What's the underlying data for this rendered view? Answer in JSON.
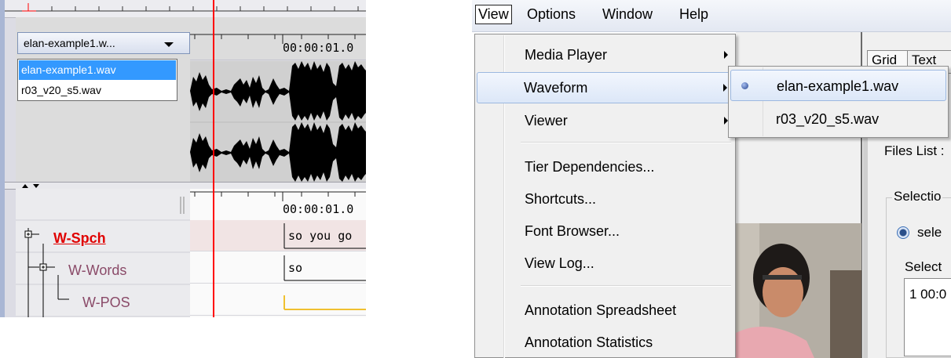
{
  "left_panel": {
    "media_combo": {
      "selected": "elan-example1.w...",
      "options": [
        "elan-example1.wav",
        "r03_v20_s5.wav"
      ]
    },
    "timecode_waveform": "00:00:01.0",
    "timecode_tiers": "00:00:01.0",
    "tiers": [
      {
        "name": "W-Spch",
        "annotation": "so you go"
      },
      {
        "name": "W-Words",
        "annotation": "so"
      },
      {
        "name": "W-POS",
        "annotation": ""
      }
    ],
    "colors": {
      "active_tier": "#e00000",
      "tier": "#8a4a68",
      "crosshair": "#ff0000",
      "pos_annotation": "#f0c030"
    }
  },
  "right_panel": {
    "menubar": {
      "view": "View",
      "options": "Options",
      "window": "Window",
      "help": "Help"
    },
    "view_menu": {
      "items": [
        {
          "label": "Media Player",
          "submenu": true
        },
        {
          "label": "Waveform",
          "submenu": true,
          "highlighted": true
        },
        {
          "label": "Viewer",
          "submenu": true
        },
        {
          "label": "Tier Dependencies..."
        },
        {
          "label": "Shortcuts..."
        },
        {
          "label": "Font Browser..."
        },
        {
          "label": "View Log..."
        },
        {
          "label": "Annotation Spreadsheet"
        },
        {
          "label": "Annotation Statistics"
        }
      ]
    },
    "waveform_submenu": {
      "items": [
        {
          "label": "elan-example1.wav",
          "selected": true
        },
        {
          "label": "r03_v20_s5.wav",
          "selected": false
        }
      ]
    },
    "background_app": {
      "tab_grid": "Grid",
      "tab_text": "Text",
      "files_list": "Files List :",
      "selection_group": "Selectio",
      "radio_label": "sele",
      "select_label": "Select",
      "list_value": "1 00:0"
    },
    "colors": {
      "highlight_border": "#9cb8e0",
      "highlight_fill": "#dce7f8"
    }
  }
}
